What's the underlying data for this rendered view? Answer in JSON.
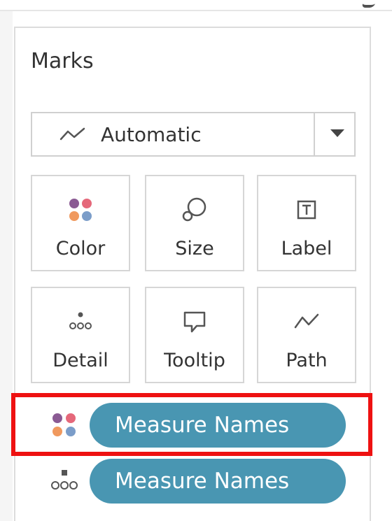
{
  "marks_panel": {
    "title": "Marks",
    "mark_type": {
      "selected": "Automatic",
      "icon": "line-chart-icon"
    },
    "cards": [
      {
        "id": "color",
        "label": "Color",
        "icon": "color-dots-icon"
      },
      {
        "id": "size",
        "label": "Size",
        "icon": "size-icon"
      },
      {
        "id": "label",
        "label": "Label",
        "icon": "text-label-icon"
      },
      {
        "id": "detail",
        "label": "Detail",
        "icon": "detail-dots-icon"
      },
      {
        "id": "tooltip",
        "label": "Tooltip",
        "icon": "speech-bubble-icon"
      },
      {
        "id": "path",
        "label": "Path",
        "icon": "path-line-icon"
      }
    ],
    "pills": [
      {
        "encoding": "color",
        "field": "Measure Names",
        "icon": "color-dots-icon",
        "highlighted": true
      },
      {
        "encoding": "detail",
        "field": "Measure Names",
        "icon": "detail-dots-icon",
        "highlighted": false
      }
    ]
  },
  "colors": {
    "pill_background": "#4996b2",
    "pill_text": "#ffffff",
    "highlight_border": "#ee1111",
    "dot_purple": "#8a5a93",
    "dot_pink": "#e5687a",
    "dot_orange": "#f0995e",
    "dot_blue": "#7b9dc9"
  }
}
